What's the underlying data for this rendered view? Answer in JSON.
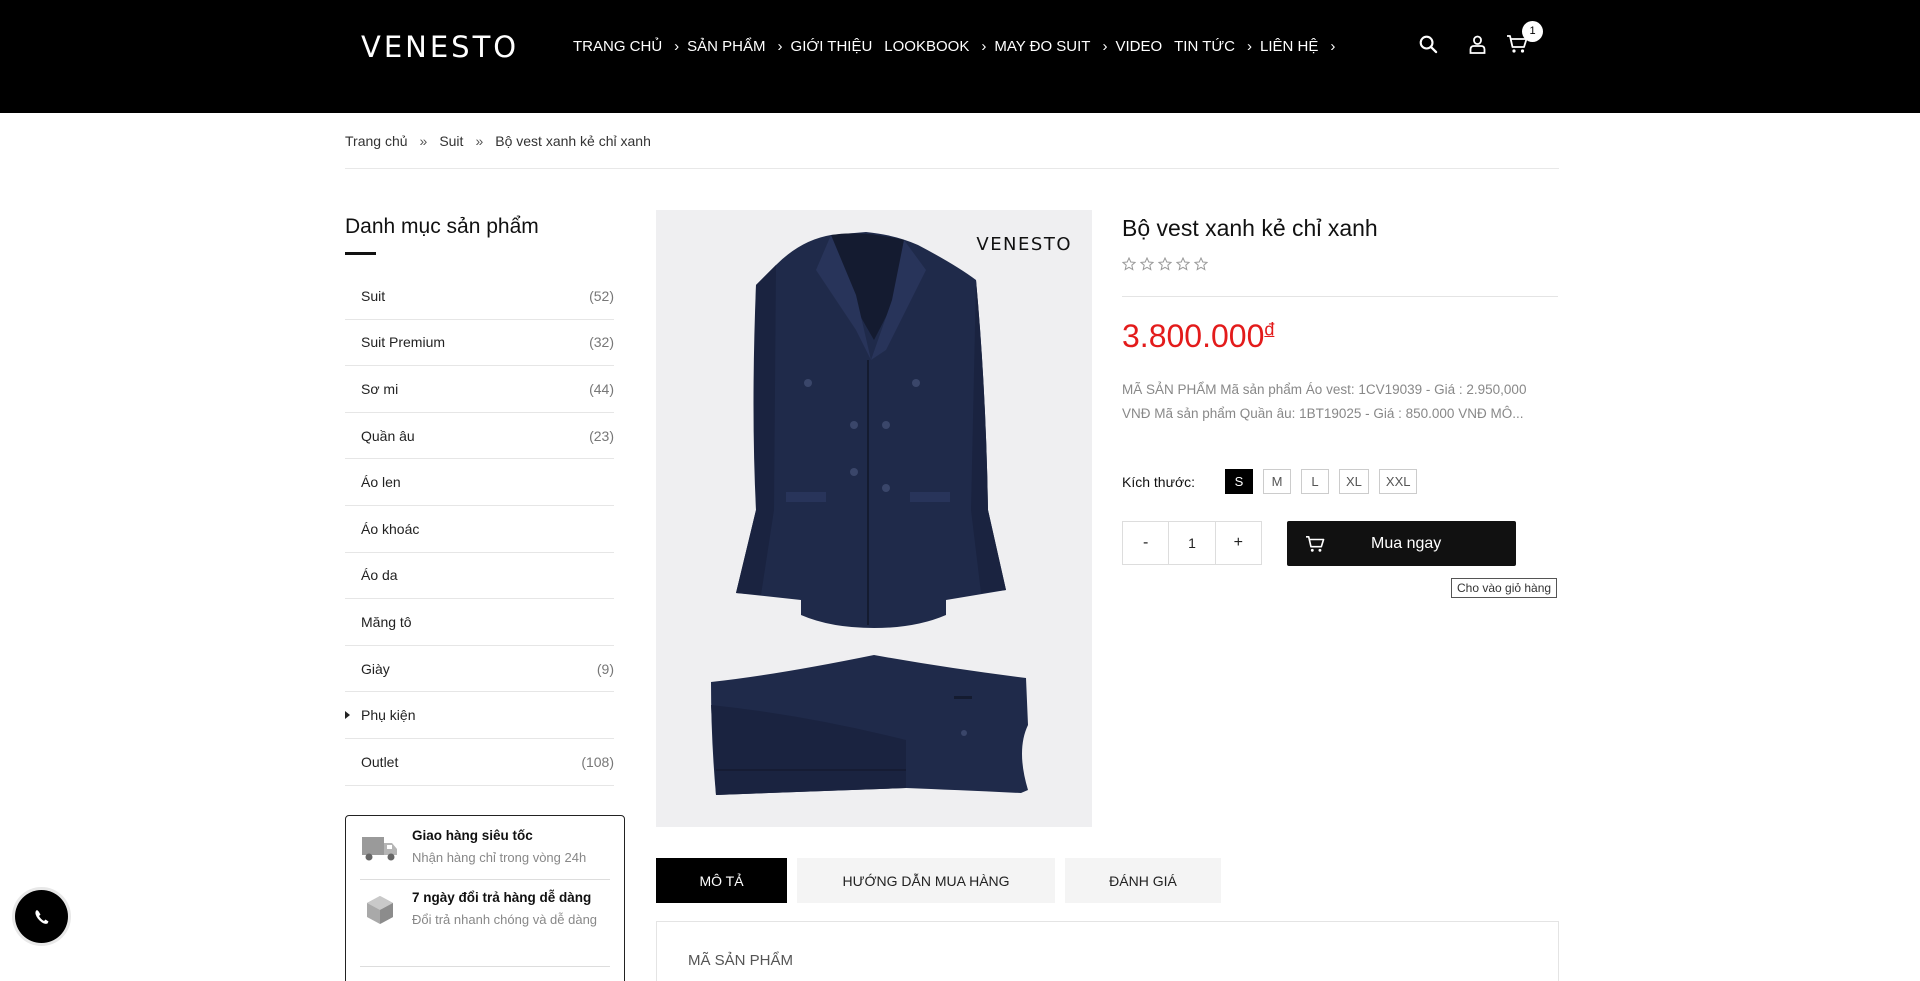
{
  "header": {
    "logo": "VENESTO",
    "nav": [
      {
        "label": "TRANG CHỦ",
        "has_chevron": true
      },
      {
        "label": "SẢN PHẨM",
        "has_chevron": true
      },
      {
        "label": "GIỚI THIỆU",
        "has_chevron": false
      },
      {
        "label": "LOOKBOOK",
        "has_chevron": true
      },
      {
        "label": "MAY ĐO SUIT",
        "has_chevron": true
      },
      {
        "label": "VIDEO",
        "has_chevron": false
      },
      {
        "label": "TIN TỨC",
        "has_chevron": true
      },
      {
        "label": "LIÊN HỆ",
        "has_chevron": true
      }
    ],
    "cart_count": "1",
    "icons": [
      "search-icon",
      "user-icon",
      "cart-icon"
    ]
  },
  "breadcrumb": {
    "items": [
      "Trang chủ",
      "Suit",
      "Bộ vest xanh kẻ chỉ xanh"
    ],
    "separator": "»"
  },
  "sidebar": {
    "title": "Danh mục sản phẩm",
    "categories": [
      {
        "label": "Suit",
        "count": "(52)"
      },
      {
        "label": "Suit Premium",
        "count": "(32)"
      },
      {
        "label": "Sơ mi",
        "count": "(44)"
      },
      {
        "label": "Quần âu",
        "count": "(23)"
      },
      {
        "label": "Áo len",
        "count": ""
      },
      {
        "label": "Áo khoác",
        "count": ""
      },
      {
        "label": "Áo da",
        "count": ""
      },
      {
        "label": "Măng tô",
        "count": ""
      },
      {
        "label": "Giày",
        "count": "(9)"
      },
      {
        "label": "Phụ kiện",
        "count": ""
      },
      {
        "label": "Outlet",
        "count": "(108)"
      }
    ],
    "services": [
      {
        "title": "Giao hàng siêu tốc",
        "desc": "Nhận hàng chỉ trong vòng 24h",
        "icon": "truck-icon"
      },
      {
        "title": "7 ngày đổi trả hàng dễ dàng",
        "desc": "Đổi trả nhanh chóng và dễ dàng",
        "icon": "box-icon"
      }
    ]
  },
  "product": {
    "image_logo": "VENESTO",
    "title": "Bộ vest xanh kẻ chỉ xanh",
    "rating_stars": 0,
    "price": "3.800.000",
    "currency": "đ",
    "description": "MÃ SẢN PHẨM Mã sản phẩm Áo vest: 1CV19039 - Giá : 2.950,000 VNĐ Mã sản phẩm Quần âu: 1BT19025 - Giá : 850.000 VNĐ MÔ...",
    "size_label": "Kích thước:",
    "sizes": [
      "S",
      "M",
      "L",
      "XL",
      "XXL"
    ],
    "selected_size": "S",
    "qty_minus": "-",
    "qty_value": "1",
    "qty_plus": "+",
    "buy_label": "Mua ngay",
    "tooltip": "Cho vào giỏ hàng"
  },
  "tabs": {
    "items": [
      "MÔ TẢ",
      "HƯỚNG DẪN MUA HÀNG",
      "ĐÁNH GIÁ"
    ],
    "active": "MÔ TẢ",
    "panel_title": "MÃ SẢN PHẨM"
  },
  "colors": {
    "header_bg": "#000000",
    "price": "#e31b1b",
    "suit": "#1d2747"
  }
}
